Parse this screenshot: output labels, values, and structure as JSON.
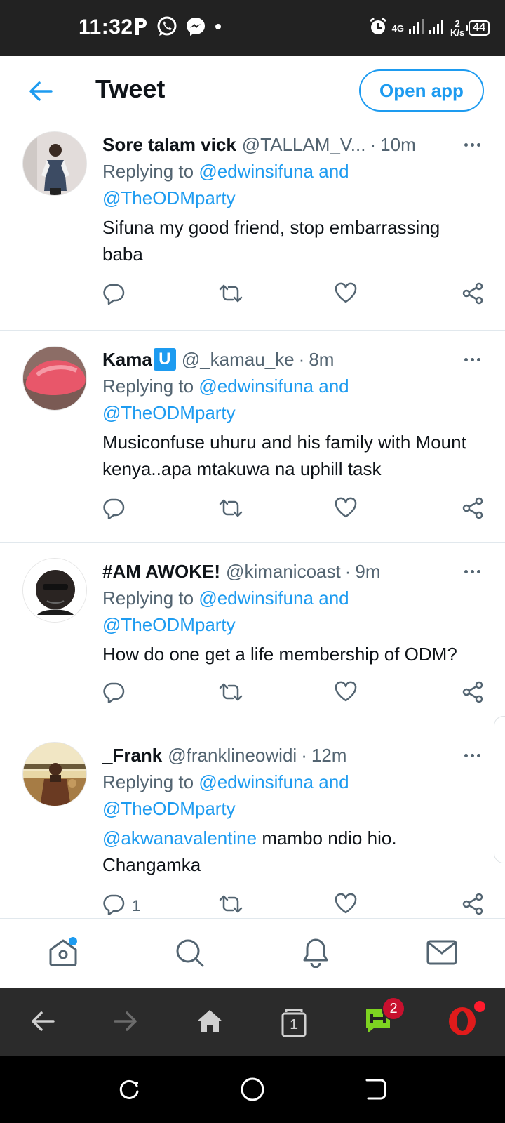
{
  "status_bar": {
    "time": "11:32",
    "network": "4G",
    "speed_value": "2",
    "speed_unit": "K/s",
    "battery": "44",
    "icons": [
      "parking-icon",
      "whatsapp-icon",
      "messenger-icon",
      "dot-icon",
      "alarm-icon",
      "signal-icon",
      "signal-icon-2"
    ]
  },
  "header": {
    "back_icon": "arrow-left-icon",
    "title": "Tweet",
    "open_app_label": "Open app"
  },
  "colors": {
    "accent": "#1d9bf0",
    "text_primary": "#0f1419",
    "text_secondary": "#536471",
    "status_bar_bg": "#222222",
    "browser_bar_bg": "#2b2b2b",
    "badge_red": "#c8102e"
  },
  "tweets": [
    {
      "name": "Sore talam vick",
      "handle": "@TALLAM_V...",
      "sep": "·",
      "time": "10m",
      "replying_prefix": "Replying to",
      "reply_mention_1": "@edwinsifuna",
      "reply_and": "and",
      "reply_mention_2": "@TheODMparty",
      "text_mention": "",
      "text": "Sifuna my good friend, stop embarrassing baba",
      "reply_count": ""
    },
    {
      "name": "Kama",
      "badge": "U",
      "handle": "@_kamau_ke",
      "sep": "·",
      "time": "8m",
      "replying_prefix": "Replying to",
      "reply_mention_1": "@edwinsifuna",
      "reply_and": "and",
      "reply_mention_2": "@TheODMparty",
      "text_mention": "",
      "text": "Musiconfuse uhuru and his family with Mount kenya..apa mtakuwa na uphill task",
      "reply_count": ""
    },
    {
      "name": "#AM AWOKE!",
      "handle": "@kimanicoast",
      "sep": "·",
      "time": "9m",
      "replying_prefix": "Replying to",
      "reply_mention_1": "@edwinsifuna",
      "reply_and": "and",
      "reply_mention_2": "@TheODMparty",
      "text_mention": "",
      "text": "How do one get a life membership of ODM?",
      "reply_count": ""
    },
    {
      "name": "_Frank",
      "handle": "@franklineowidi",
      "sep": "·",
      "time": "12m",
      "replying_prefix": "Replying to",
      "reply_mention_1": "@edwinsifuna",
      "reply_and": "and",
      "reply_mention_2": "@TheODMparty",
      "text_mention": "@akwanavalentine",
      "text": " mambo ndio hio. Changamka",
      "reply_count": "1"
    }
  ],
  "bottom_nav": {
    "items": [
      "home-icon",
      "search-icon",
      "notifications-icon",
      "messages-icon"
    ]
  },
  "browser_bar": {
    "tabs_count": "1",
    "chat_badge": "2",
    "items": [
      "back-arrow-icon",
      "forward-arrow-icon",
      "home-icon",
      "tabs-icon",
      "chat-icon",
      "opera-icon"
    ]
  },
  "system_nav": {
    "items": [
      "recent-apps-icon",
      "home-circle-icon",
      "back-icon"
    ]
  }
}
